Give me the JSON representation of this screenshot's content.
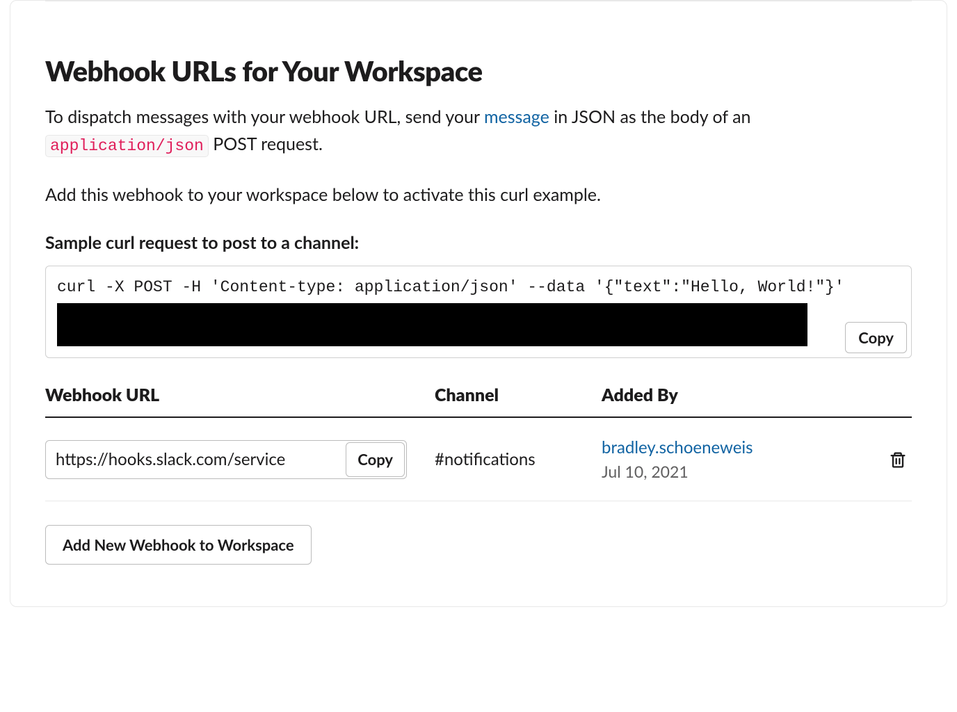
{
  "section": {
    "title": "Webhook URLs for Your Workspace",
    "desc_part1": "To dispatch messages with your webhook URL, send your ",
    "desc_link": "message",
    "desc_part2": " in JSON as the body of an ",
    "desc_code": "application/json",
    "desc_part3": " POST request.",
    "desc2": "Add this webhook to your workspace below to activate this curl example.",
    "sample_label": "Sample curl request to post to a channel:",
    "curl_code": "curl -X POST -H 'Content-type: application/json' --data '{\"text\":\"Hello, World!\"}'",
    "copy_label": "Copy"
  },
  "table": {
    "headers": {
      "url": "Webhook URL",
      "channel": "Channel",
      "added_by": "Added By"
    },
    "rows": [
      {
        "url": "https://hooks.slack.com/service",
        "copy_label": "Copy",
        "channel": "#notifications",
        "added_by_user": "bradley.schoeneweis",
        "added_by_date": "Jul 10, 2021"
      }
    ]
  },
  "add_button": "Add New Webhook to Workspace"
}
